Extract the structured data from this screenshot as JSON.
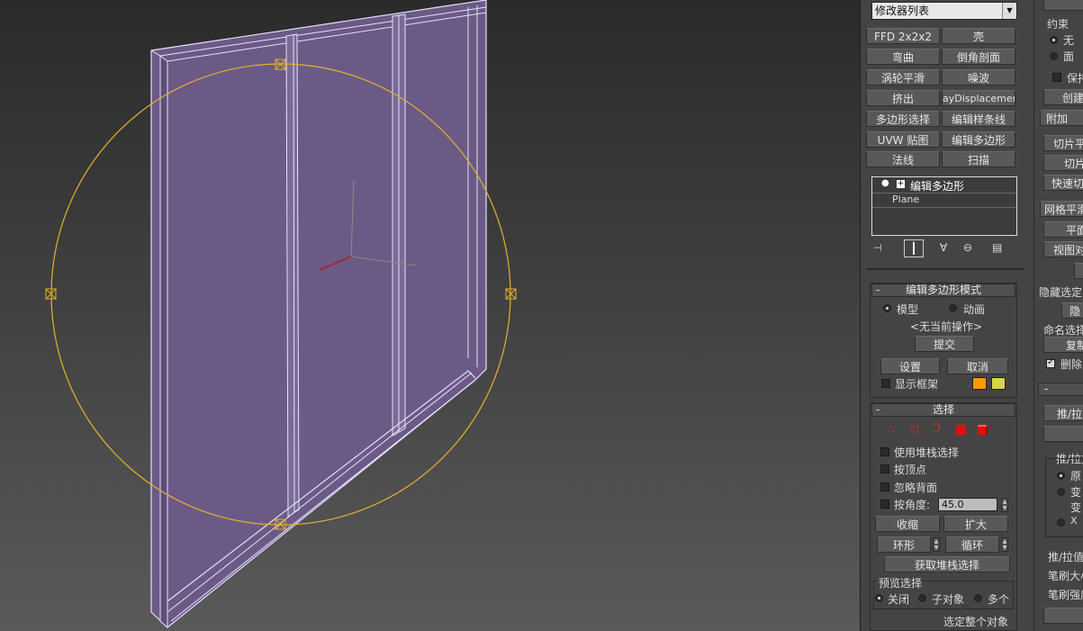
{
  "viewport": {
    "label": "3D viewport"
  },
  "modifier_list": {
    "value": "修改器列表"
  },
  "modifier_buttons": [
    "FFD 2x2x2",
    "壳",
    "弯曲",
    "倒角剖面",
    "涡轮平滑",
    "噪波",
    "挤出",
    "ayDisplacementM",
    "多边形选择",
    "编辑样条线",
    "UVW 贴图",
    "编辑多边形",
    "法线",
    "扫描"
  ],
  "stack": {
    "item1": "编辑多边形",
    "item2": "Plane"
  },
  "edit_poly_mode": {
    "title": "编辑多边形模式",
    "model": "模型",
    "anim": "动画",
    "no_op": "<无当前操作>",
    "commit": "提交",
    "settings": "设置",
    "cancel": "取消",
    "show_cage": "显示框架",
    "cage_color1": "#ff9900",
    "cage_color2": "#d6d64a"
  },
  "select": {
    "title": "选择",
    "use_stack": "使用堆栈选择",
    "by_vertex": "按顶点",
    "ignore_back": "忽略背面",
    "by_angle": "按角度:",
    "angle_value": "45.0",
    "shrink": "收缩",
    "grow": "扩大",
    "ring": "环形",
    "loop": "循环",
    "get_stack": "获取堆栈选择",
    "preview": "预览选择",
    "off": "关闭",
    "sub": "子对象",
    "multi": "多个",
    "select_whole": "选定整个对象"
  },
  "right_panel": {
    "constraint": "约束",
    "none": "无",
    "face": "面",
    "keep": "保持",
    "create": "创建",
    "attach": "附加",
    "slice_plane": "切片平",
    "slice": "切片",
    "quick_slice": "快速切",
    "mesh_smooth": "网格平滑",
    "planar": "平面",
    "view_align": "视图对",
    "hide_sel": "隐藏选定",
    "hide": "隐",
    "named_sel": "命名选择",
    "copy": "复制",
    "delete": "删除",
    "push_pull": "推/拉",
    "push_pull2": "推/拉方",
    "orig": "原",
    "trans": "变",
    "trans2": "变",
    "x": "X",
    "push_val": "推/拉值",
    "brush_size": "笔刷大小",
    "brush_strength": "笔刷强度"
  }
}
